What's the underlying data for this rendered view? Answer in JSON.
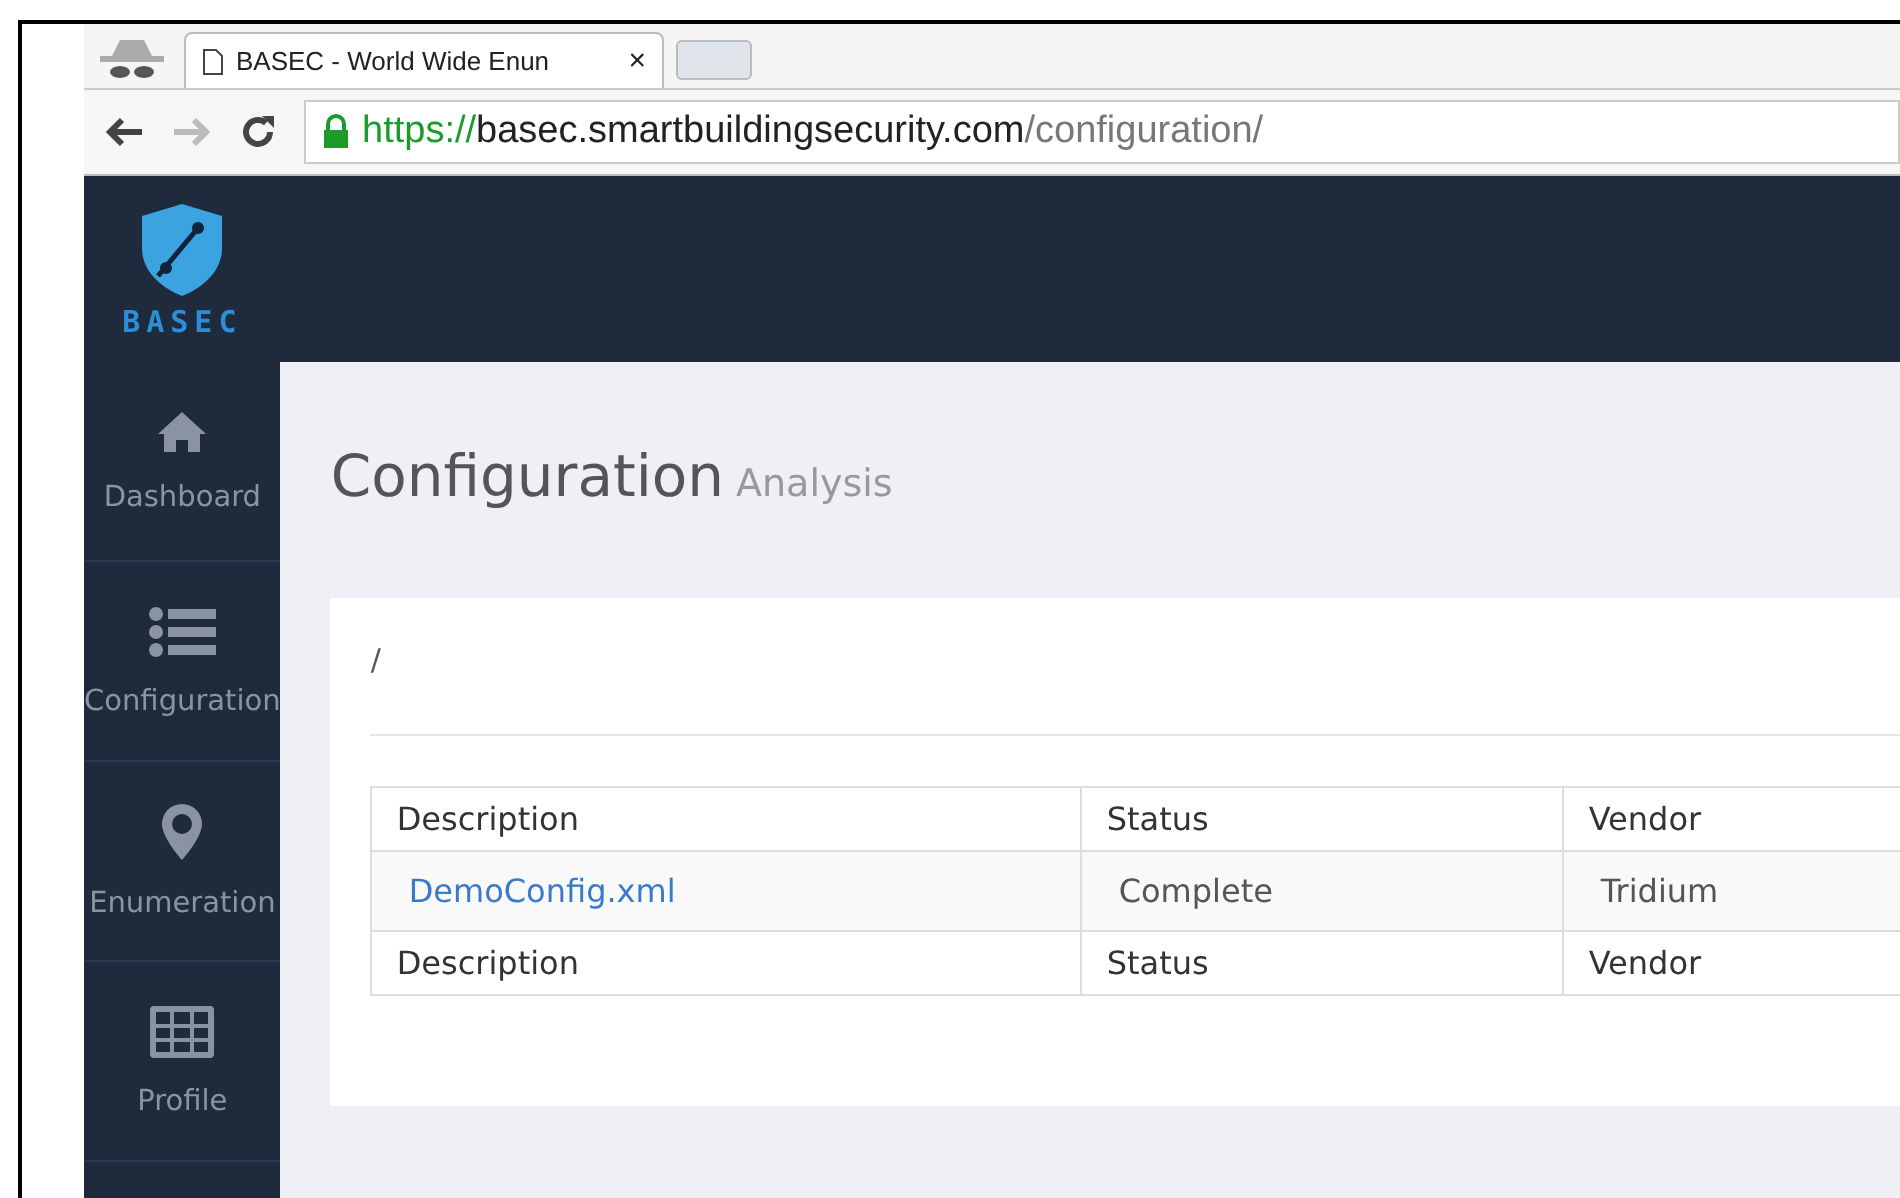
{
  "browser": {
    "tab_title": "BASEC - World Wide Enun",
    "close": "×",
    "url_scheme": "https://",
    "url_host": "basec.smartbuildingsecurity.com",
    "url_path": "/configuration/"
  },
  "sidebar": {
    "logo_text": "BASEC",
    "items": [
      {
        "label": "Dashboard",
        "kind": "home"
      },
      {
        "label": "Configuration",
        "kind": "list"
      },
      {
        "label": "Enumeration",
        "kind": "pin"
      },
      {
        "label": "Profile",
        "kind": "table"
      }
    ]
  },
  "page": {
    "title": "Configuration",
    "subtitle": "Analysis",
    "breadcrumb": "/"
  },
  "table": {
    "columns": [
      "Description",
      "Status",
      "Vendor"
    ],
    "rows": [
      {
        "cells": [
          "DemoConfig.xml",
          "Complete",
          "Tridium"
        ]
      }
    ],
    "footer": [
      "Description",
      "Status",
      "Vendor"
    ]
  }
}
